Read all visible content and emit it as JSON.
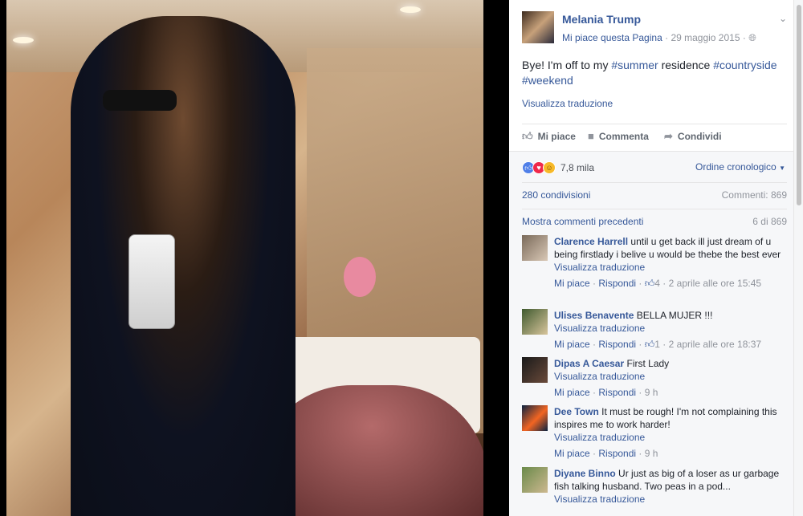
{
  "page": {
    "name": "Melania Trump",
    "like_page": "Mi piace questa Pagina",
    "date": "29 maggio 2015",
    "separator": "·",
    "audience_icon": "globe-icon"
  },
  "post": {
    "text_parts": [
      "Bye! I'm off to my ",
      "#summer",
      " residence ",
      "#countryside",
      "#weekend"
    ],
    "translate": "Visualizza traduzione"
  },
  "actions": {
    "like": "Mi piace",
    "comment": "Commenta",
    "share": "Condividi"
  },
  "stats": {
    "reactions_count": "7,8 mila",
    "sort": "Ordine cronologico",
    "shares": "280 condivisioni",
    "comments": "Commenti: 869",
    "more_comments": "Mostra commenti precedenti",
    "counter": "6 di 869"
  },
  "colors": {
    "link": "#365899",
    "like": "#4f7fe8",
    "love": "#f0284a",
    "haha": "#f7b928"
  },
  "comments": [
    {
      "author": "Clarence Harrell",
      "text": "until u get back ill just dream of u being firstlady i belive u would be thebe the best ever",
      "translate": "Visualizza traduzione",
      "like": "Mi piace",
      "reply": "Rispondi",
      "likes": "4",
      "time": "2 aprile alle ore 15:45"
    },
    {
      "author": "Ulises Benavente",
      "text": "BELLA MUJER !!!",
      "translate": "Visualizza traduzione",
      "like": "Mi piace",
      "reply": "Rispondi",
      "likes": "1",
      "time": "2 aprile alle ore 18:37"
    },
    {
      "author": "Dipas A Caesar",
      "text": "First Lady",
      "translate": "Visualizza traduzione",
      "like": "Mi piace",
      "reply": "Rispondi",
      "time": "9 h"
    },
    {
      "author": "Dee Town",
      "text": "It must be rough! I'm not complaining this inspires me to work harder!",
      "translate": "Visualizza traduzione",
      "like": "Mi piace",
      "reply": "Rispondi",
      "time": "9 h"
    },
    {
      "author": "Diyane Binno",
      "text": "Ur just as big of a loser as ur garbage fish talking husband. Two peas in a pod...",
      "translate": "Visualizza traduzione"
    }
  ]
}
